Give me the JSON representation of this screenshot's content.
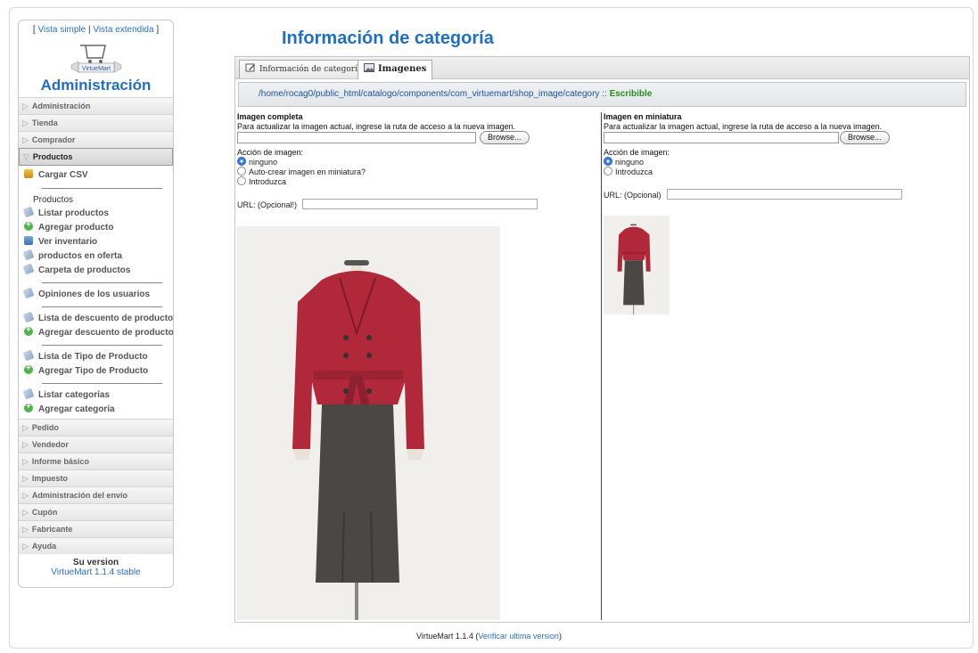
{
  "sidebar": {
    "view_simple": "Vista simple",
    "view_sep": "|",
    "view_extended": "Vista extendida",
    "bracket_open": "[",
    "bracket_close": "]",
    "logo_text": "VirtueMart",
    "title": "Administración",
    "sections_top": [
      "Administración",
      "Tienda",
      "Comprador"
    ],
    "open_section": "Productos",
    "product_items": {
      "csv": "Cargar CSV",
      "heading": "Productos",
      "list_products": "Listar productos",
      "add_product": "Agregar producto",
      "inventory": "Ver inventario",
      "on_sale": "productos en oferta",
      "folder": "Carpeta de productos",
      "reviews": "Opiniones de los usuarios",
      "discount_list": "Lista de descuento de productos",
      "discount_add": "Agregar descuento de producto",
      "type_list": "Lista de Tipo de Producto",
      "type_add": "Agregar Tipo de Producto",
      "cat_list": "Listar categorías",
      "cat_add": "Agregar categoría"
    },
    "sections_bottom": [
      "Pedido",
      "Vendedor",
      "Informe básico",
      "Impuesto",
      "Administración del envío",
      "Cupón",
      "Fabricante",
      "Ayuda"
    ],
    "version_label": "Su version",
    "version_value": "VirtueMart 1.1.4 stable"
  },
  "main": {
    "title": "Información de categoría",
    "tabs": [
      {
        "label": "Información de categoría",
        "icon": "edit-icon"
      },
      {
        "label": "Imagenes",
        "icon": "image-icon"
      }
    ],
    "path": "/home/rocag0/public_html/catalogo/components/com_virtuemart/shop_image/category",
    "path_sep": " :: ",
    "path_status": "Escribible",
    "full_image": {
      "heading": "Imagen completa",
      "hint": "Para actualizar la imagen actual, ingrese la ruta de acceso a la nueva imagen.",
      "browse": "Browse...",
      "action_label": "Acción de imagen:",
      "options": [
        "ninguno",
        "Auto-crear imagen en miniatura?",
        "Introduzca"
      ],
      "selected": "ninguno",
      "url_label": "URL: (Opcional!)"
    },
    "thumb_image": {
      "heading": "Imagen en miniatura",
      "hint": "Para actualizar la imagen actual, ingrese la ruta de acceso a la nueva imagen.",
      "browse": "Browse...",
      "action_label": "Acción de imagen:",
      "options": [
        "ninguno",
        "Introduzca"
      ],
      "selected": "ninguno",
      "url_label": "URL: (Opcional)"
    }
  },
  "footer": {
    "text": "VirtueMart 1.1.4",
    "link_open": " (",
    "link": "Verificar ultima version",
    "link_close": ")"
  },
  "colors": {
    "accent_blue": "#1f6fc7",
    "status_green": "#2a8a1e",
    "jacket_red": "#b0283a",
    "skirt_gray": "#4a4744"
  }
}
